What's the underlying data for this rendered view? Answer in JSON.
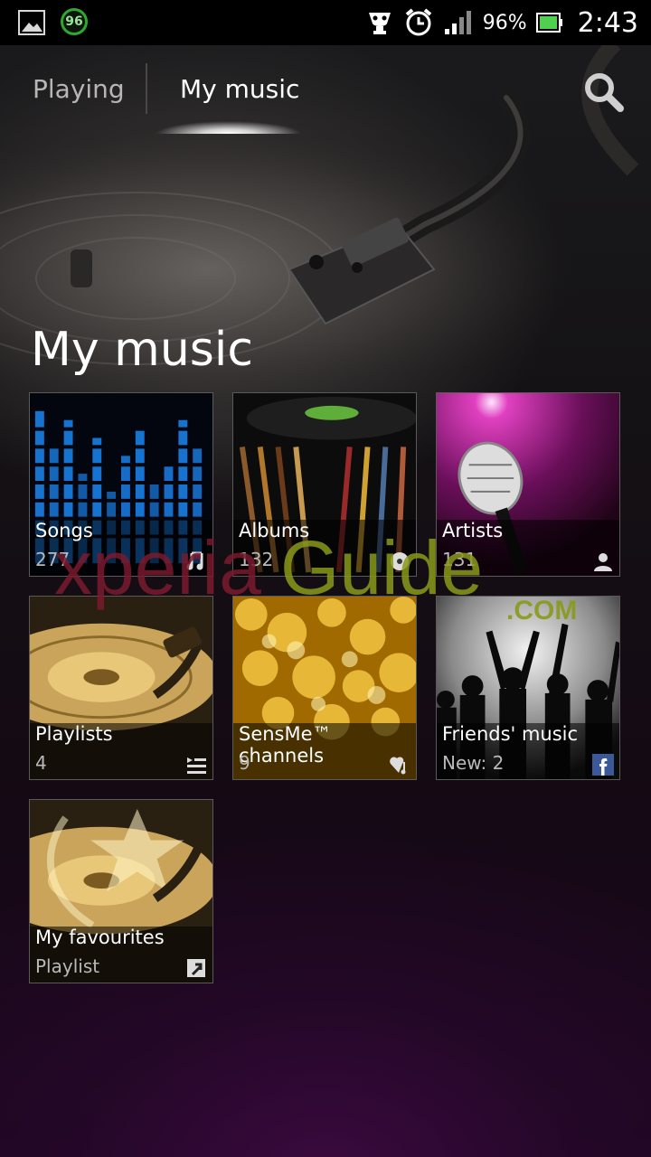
{
  "status_bar": {
    "notification_badge": "96",
    "battery_percent": "96%",
    "time": "2:43",
    "icons": [
      "gallery-icon",
      "battery-saver-icon",
      "usb-trophy-icon",
      "alarm-icon",
      "signal-icon",
      "battery-icon"
    ]
  },
  "tabs": [
    {
      "label": "Playing",
      "selected": false
    },
    {
      "label": "My music",
      "selected": true
    }
  ],
  "header": {
    "title": "My music"
  },
  "tiles": [
    {
      "title": "Songs",
      "subtitle": "277",
      "icon": "music-notes-icon"
    },
    {
      "title": "Albums",
      "subtitle": "132",
      "icon": "disc-icon"
    },
    {
      "title": "Artists",
      "subtitle": "131",
      "icon": "person-icon"
    },
    {
      "title": "Playlists",
      "subtitle": "4",
      "icon": "playlist-icon"
    },
    {
      "title": "SensMe™ channels",
      "subtitle": "9",
      "icon": "heart-note-icon"
    },
    {
      "title": "Friends' music",
      "subtitle": "New: 2",
      "icon": "facebook-icon"
    },
    {
      "title": "My favourites",
      "subtitle": "Playlist",
      "icon": "shortcut-arrow-icon"
    }
  ],
  "watermark": {
    "text_main": "xperiaGuide",
    "text_sub": ".COM"
  },
  "colors": {
    "accent_glow": "#ffffff",
    "watermark_red": "#7a1a2e",
    "watermark_green": "#8a9a1a",
    "battery_green": "#2fa82f"
  }
}
